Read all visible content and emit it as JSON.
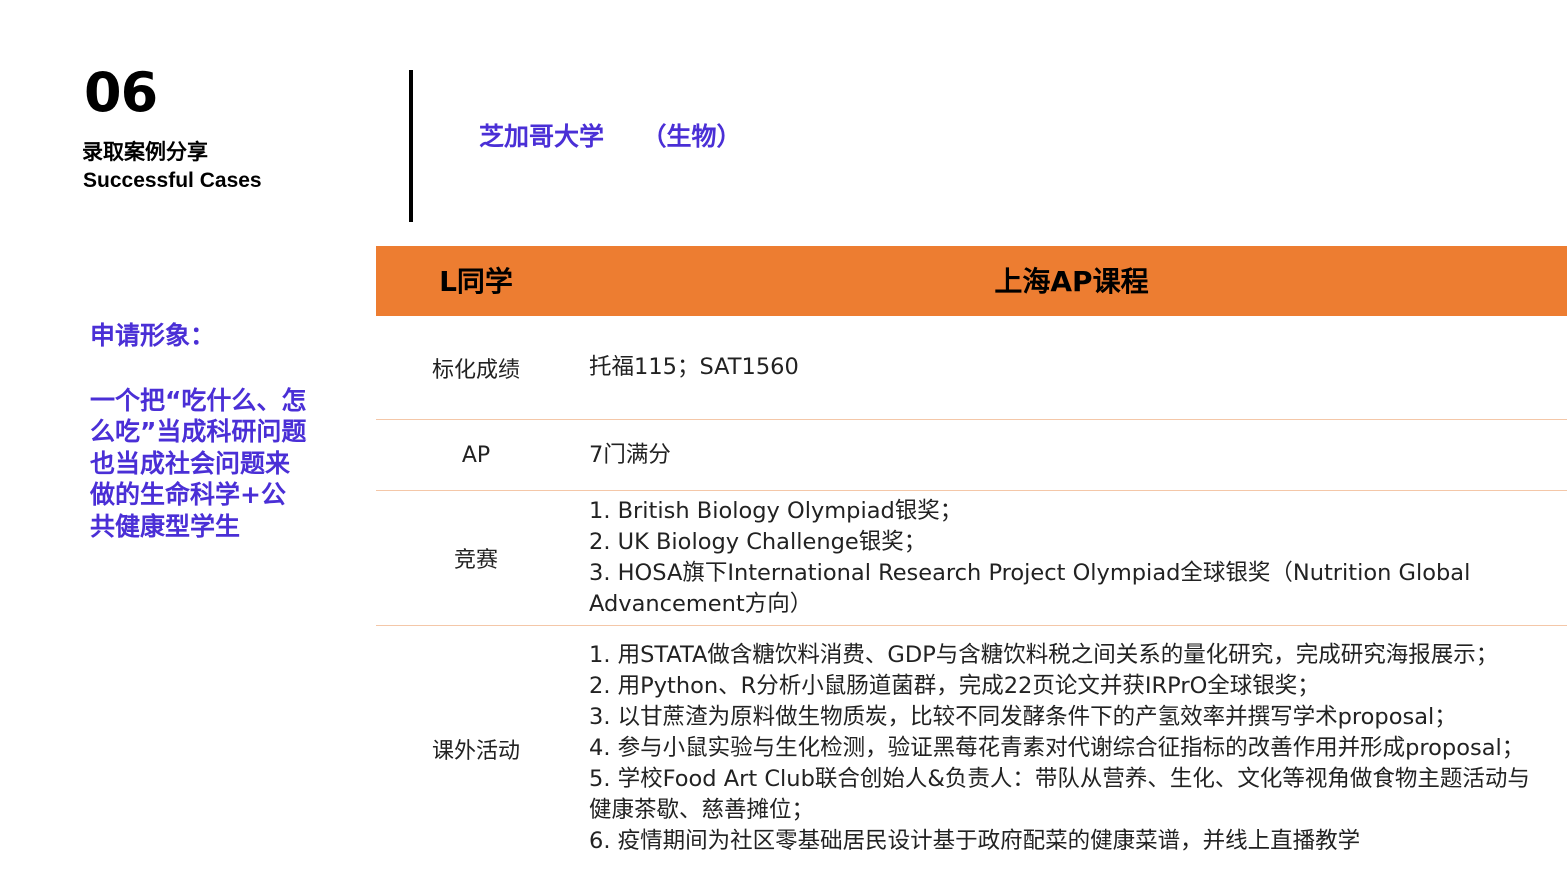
{
  "header": {
    "section_number": "06",
    "title_cn": "录取案例分享",
    "title_en": "Successful Cases"
  },
  "university": {
    "title": "芝加哥大学　　（生物）"
  },
  "profile": {
    "heading": "申请形象：",
    "description": "一个把“吃什么、怎么吃”当成科研问题也当成社会问题来做的生命科学+公共健康型学生"
  },
  "table": {
    "student_label": "L同学",
    "program_label": "上海AP课程",
    "rows": [
      {
        "label": "标化成绩",
        "items": [
          "托福115；SAT1560"
        ]
      },
      {
        "label": "AP",
        "items": [
          "7门满分"
        ]
      },
      {
        "label": "竞赛",
        "items": [
          "1. British Biology Olympiad银奖；",
          "2. UK Biology Challenge银奖；",
          "3. HOSA旗下International Research Project Olympiad全球银奖（Nutrition Global Advancement方向）"
        ]
      },
      {
        "label": "课外活动",
        "items": [
          "1. 用STATA做含糖饮料消费、GDP与含糖饮料税之间关系的量化研究，完成研究海报展示；",
          "2. 用Python、R分析小鼠肠道菌群，完成22页论文并获IRPrO全球银奖；",
          "3. 以甘蔗渣为原料做生物质炭，比较不同发酵条件下的产氢效率并撰写学术proposal；",
          "4. 参与小鼠实验与生化检测，验证黑莓花青素对代谢综合征指标的改善作用并形成proposal；",
          "5. 学校Food Art Club联合创始人&负责人：带队从营养、生化、文化等视角做食物主题活动与健康茶歇、慈善摊位；",
          "6. 疫情期间为社区零基础居民设计基于政府配菜的健康菜谱，并线上直播教学"
        ]
      }
    ]
  },
  "colors": {
    "accent_purple": "#4a2fd6",
    "header_orange": "#ed7d31",
    "row_divider": "#f4c7a8"
  }
}
